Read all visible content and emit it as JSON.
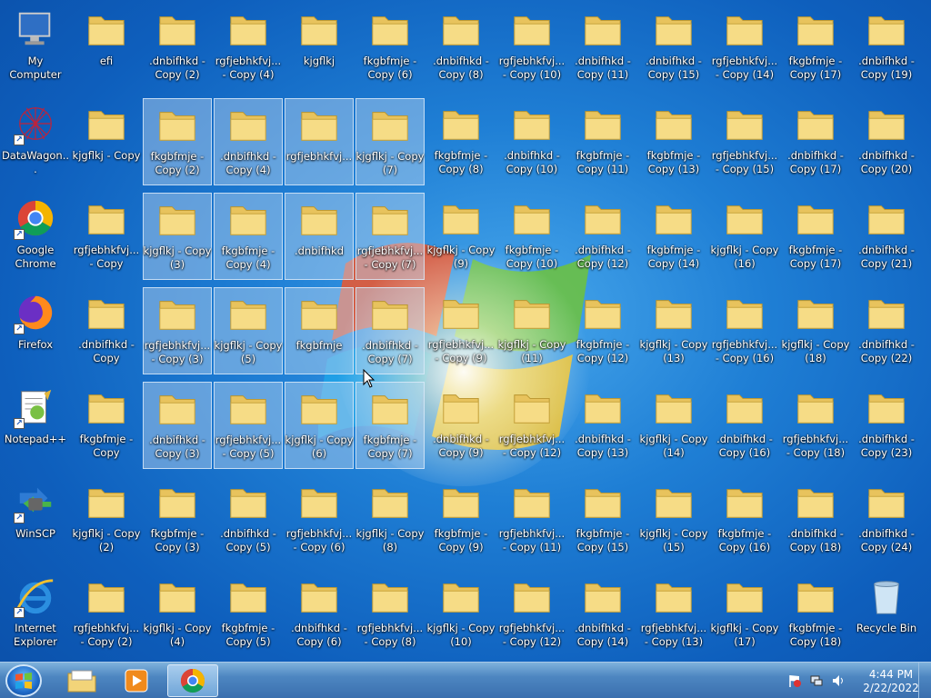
{
  "desktop": {
    "icons": [
      {
        "label": "My Computer",
        "type": "computer"
      },
      {
        "label": "DataWagon...",
        "type": "datawagon"
      },
      {
        "label": "Google Chrome",
        "type": "chrome"
      },
      {
        "label": "Firefox",
        "type": "firefox"
      },
      {
        "label": "Notepad++",
        "type": "notepadpp"
      },
      {
        "label": "WinSCP",
        "type": "winscp"
      },
      {
        "label": "Internet Explorer",
        "type": "ie"
      },
      {
        "label": "efi"
      },
      {
        "label": "kjgflkj - Copy"
      },
      {
        "label": "rgfjebhkfvj... - Copy"
      },
      {
        "label": ".dnbifhkd - Copy"
      },
      {
        "label": "fkgbfmje - Copy"
      },
      {
        "label": "kjgflkj - Copy (2)"
      },
      {
        "label": "rgfjebhkfvj... - Copy (2)"
      },
      {
        "label": ".dnbifhkd - Copy (2)"
      },
      {
        "label": "fkgbfmje - Copy (2)",
        "selected": true
      },
      {
        "label": "kjgflkj - Copy (3)",
        "selected": true
      },
      {
        "label": "rgfjebhkfvj... - Copy (3)",
        "selected": true
      },
      {
        "label": ".dnbifhkd - Copy (3)",
        "selected": true
      },
      {
        "label": "fkgbfmje - Copy (3)"
      },
      {
        "label": "kjgflkj - Copy (4)"
      },
      {
        "label": "rgfjebhkfvj... - Copy (4)"
      },
      {
        "label": ".dnbifhkd - Copy (4)",
        "selected": true
      },
      {
        "label": "fkgbfmje - Copy (4)",
        "selected": true
      },
      {
        "label": "kjgflkj - Copy (5)",
        "selected": true
      },
      {
        "label": "rgfjebhkfvj... - Copy (5)",
        "selected": true
      },
      {
        "label": ".dnbifhkd - Copy (5)"
      },
      {
        "label": "fkgbfmje - Copy (5)"
      },
      {
        "label": "kjgflkj"
      },
      {
        "label": "rgfjebhkfvj...",
        "selected": true
      },
      {
        "label": ".dnbifhkd",
        "selected": true
      },
      {
        "label": "fkgbfmje",
        "selected": true
      },
      {
        "label": "kjgflkj - Copy (6)",
        "selected": true
      },
      {
        "label": "rgfjebhkfvj... - Copy (6)"
      },
      {
        "label": ".dnbifhkd - Copy (6)"
      },
      {
        "label": "fkgbfmje - Copy (6)"
      },
      {
        "label": "kjgflkj - Copy (7)",
        "selected": true
      },
      {
        "label": "rgfjebhkfvj... - Copy (7)",
        "selected": true
      },
      {
        "label": ".dnbifhkd - Copy (7)",
        "selected": true
      },
      {
        "label": "fkgbfmje - Copy (7)",
        "selected": true
      },
      {
        "label": "kjgflkj - Copy (8)"
      },
      {
        "label": "rgfjebhkfvj... - Copy (8)"
      },
      {
        "label": ".dnbifhkd - Copy (8)"
      },
      {
        "label": "fkgbfmje - Copy (8)"
      },
      {
        "label": "kjgflkj - Copy (9)"
      },
      {
        "label": "rgfjebhkfvj... - Copy (9)"
      },
      {
        "label": ".dnbifhkd - Copy (9)"
      },
      {
        "label": "fkgbfmje - Copy (9)"
      },
      {
        "label": "kjgflkj - Copy (10)"
      },
      {
        "label": "rgfjebhkfvj... - Copy (10)"
      },
      {
        "label": ".dnbifhkd - Copy (10)"
      },
      {
        "label": "fkgbfmje - Copy (10)"
      },
      {
        "label": "kjgflkj - Copy (11)"
      },
      {
        "label": "rgfjebhkfvj... - Copy (12)"
      },
      {
        "label": "rgfjebhkfvj... - Copy (11)"
      },
      {
        "label": "rgfjebhkfvj... - Copy (12)"
      },
      {
        "label": ".dnbifhkd - Copy (11)"
      },
      {
        "label": "fkgbfmje - Copy (11)"
      },
      {
        "label": ".dnbifhkd - Copy (12)"
      },
      {
        "label": "fkgbfmje - Copy (12)"
      },
      {
        "label": ".dnbifhkd - Copy (13)"
      },
      {
        "label": "fkgbfmje - Copy (15)"
      },
      {
        "label": ".dnbifhkd - Copy (14)"
      },
      {
        "label": ".dnbifhkd - Copy (15)"
      },
      {
        "label": "fkgbfmje - Copy (13)"
      },
      {
        "label": "fkgbfmje - Copy (14)"
      },
      {
        "label": "kjgflkj - Copy (13)"
      },
      {
        "label": "kjgflkj - Copy (14)"
      },
      {
        "label": "kjgflkj - Copy (15)"
      },
      {
        "label": "rgfjebhkfvj... - Copy (13)"
      },
      {
        "label": "rgfjebhkfvj... - Copy (14)"
      },
      {
        "label": "rgfjebhkfvj... - Copy (15)"
      },
      {
        "label": "kjgflkj - Copy (16)"
      },
      {
        "label": "rgfjebhkfvj... - Copy (16)"
      },
      {
        "label": ".dnbifhkd - Copy (16)"
      },
      {
        "label": "fkgbfmje - Copy (16)"
      },
      {
        "label": "kjgflkj - Copy (17)"
      },
      {
        "label": "fkgbfmje - Copy (17)"
      },
      {
        "label": ".dnbifhkd - Copy (17)"
      },
      {
        "label": "fkgbfmje - Copy (17)"
      },
      {
        "label": "kjgflkj - Copy (18)"
      },
      {
        "label": "rgfjebhkfvj... - Copy (18)"
      },
      {
        "label": ".dnbifhkd - Copy (18)"
      },
      {
        "label": "fkgbfmje - Copy (18)"
      },
      {
        "label": ".dnbifhkd - Copy (19)"
      },
      {
        "label": ".dnbifhkd - Copy (20)"
      },
      {
        "label": ".dnbifhkd - Copy (21)"
      },
      {
        "label": ".dnbifhkd - Copy (22)"
      },
      {
        "label": ".dnbifhkd - Copy (23)"
      },
      {
        "label": ".dnbifhkd - Copy (24)"
      },
      {
        "label": "Recycle Bin",
        "type": "recycle"
      }
    ]
  },
  "taskbar": {
    "pinned": [
      "windows-explorer",
      "media-player",
      "google-chrome"
    ],
    "clock_time": "4:44 PM",
    "clock_date": "2/22/2022"
  },
  "colors": {
    "folder": "#f2d479",
    "taskbar": "#4d86c1",
    "selection": "#bed7f0"
  }
}
